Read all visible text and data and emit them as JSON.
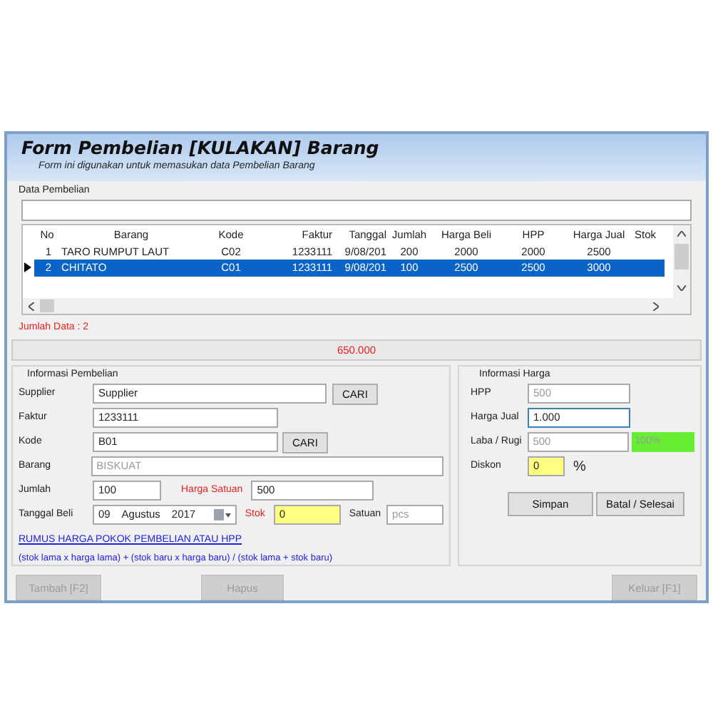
{
  "header": {
    "title": "Form Pembelian [KULAKAN] Barang",
    "subtitle": "Form ini digunakan untuk memasukan data  Pembelian Barang"
  },
  "data_section": {
    "label": "Data Pembelian"
  },
  "table": {
    "columns": [
      "No",
      "Barang",
      "Kode",
      "Faktur",
      "Tanggal",
      "Jumlah",
      "Harga Beli",
      "HPP",
      "Harga Jual",
      "Stok"
    ],
    "rows": [
      {
        "cells": [
          "1",
          "TARO RUMPUT LAUT",
          "C02",
          "1233111",
          "9/08/201",
          "200",
          "2000",
          "2000",
          "2500"
        ],
        "selected": false
      },
      {
        "cells": [
          "2",
          "CHITATO",
          "C01",
          "1233111",
          "9/08/201",
          "100",
          "2500",
          "2500",
          "3000"
        ],
        "selected": true
      }
    ]
  },
  "count_text": "Jumlah Data : 2",
  "total": "650.000",
  "purchase_info": {
    "title": "Informasi Pembelian",
    "supplier": {
      "label": "Supplier",
      "value": "Supplier",
      "button": "CARI"
    },
    "faktur": {
      "label": "Faktur",
      "value": "1233111"
    },
    "kode": {
      "label": "Kode",
      "value": "B01",
      "button": "CARI"
    },
    "barang": {
      "label": "Barang",
      "value": "BISKUAT",
      "disabled": true
    },
    "jumlah": {
      "label": "Jumlah",
      "value": "100"
    },
    "harga_satuan": {
      "label": "Harga Satuan",
      "value": "500"
    },
    "tanggal": {
      "label": "Tanggal Beli",
      "day": "09",
      "month": "Agustus",
      "year": "2017"
    },
    "stok": {
      "label": "Stok",
      "value": "0",
      "highlighted": true
    },
    "satuan": {
      "label": "Satuan",
      "value": "pcs",
      "disabled": true
    },
    "formula_link": "RUMUS HARGA POKOK PEMBELIAN ATAU HPP",
    "formula": "(stok lama x harga lama) + (stok baru x harga baru) / (stok lama + stok baru)"
  },
  "price_info": {
    "title": "Informasi Harga",
    "hpp": {
      "label": "HPP",
      "value": "500",
      "disabled": true
    },
    "harga_jual": {
      "label": "Harga Jual",
      "value": "1.000",
      "focused": true
    },
    "laba": {
      "label": "Laba / Rugi",
      "value": "500",
      "disabled": true,
      "percent": "100%",
      "profit": true
    },
    "diskon": {
      "label": "Diskon",
      "value": "0",
      "unit": "%",
      "highlighted": true
    },
    "buttons": [
      {
        "label": "Simpan",
        "disabled": false
      },
      {
        "label": "Batal / Selesai",
        "disabled": false
      }
    ]
  },
  "footer_buttons": [
    {
      "label": "Tambah [F2]",
      "disabled": true
    },
    {
      "label": "Hapus",
      "disabled": true
    },
    {
      "label": "Keluar [F1]",
      "disabled": true
    }
  ]
}
